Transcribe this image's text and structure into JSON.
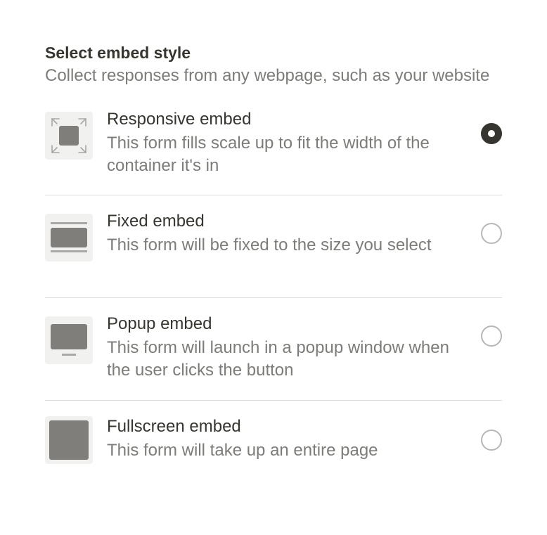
{
  "header": {
    "title": "Select embed style",
    "subtitle": "Collect responses from any webpage, such as your website"
  },
  "options": [
    {
      "title": "Responsive embed",
      "description": "This form fills scale up to fit the width of the container it's in",
      "icon": "responsive-embed-icon",
      "selected": true
    },
    {
      "title": "Fixed embed",
      "description": "This form will be fixed to the size you select",
      "icon": "fixed-embed-icon",
      "selected": false
    },
    {
      "title": "Popup embed",
      "description": "This form will launch in a popup window when the user clicks the button",
      "icon": "popup-embed-icon",
      "selected": false
    },
    {
      "title": "Fullscreen embed",
      "description": "This form will take up an entire page",
      "icon": "fullscreen-embed-icon",
      "selected": false
    }
  ],
  "colors": {
    "text": "#37352f",
    "muted": "#7d7c78",
    "icon_fill": "#7f7e7b",
    "thumb_bg": "#f1f1ef",
    "divider": "#dedddb"
  }
}
